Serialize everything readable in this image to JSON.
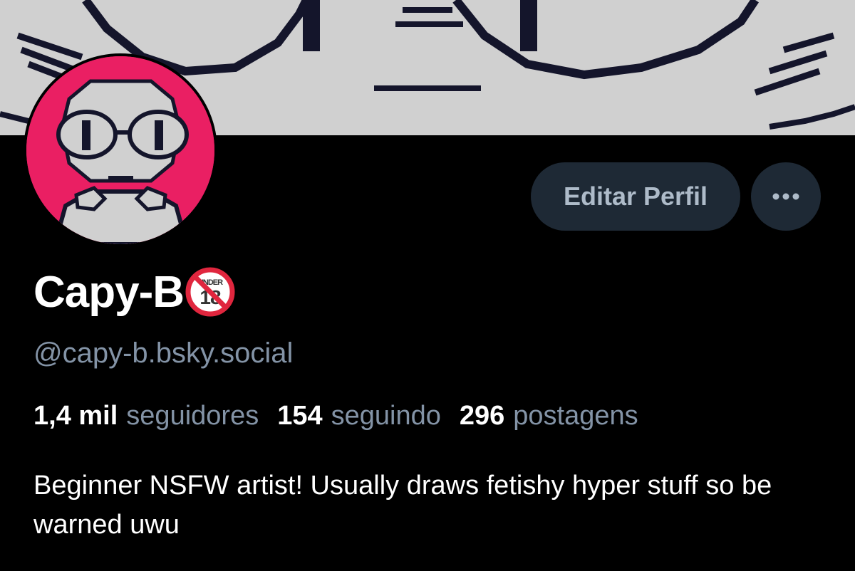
{
  "profile": {
    "display_name": "Capy-B",
    "badge_text": "UNDER",
    "badge_number": "18",
    "handle": "@capy-b.bsky.social",
    "bio": "Beginner NSFW artist! Usually draws fetishy hyper stuff so be warned uwu"
  },
  "actions": {
    "edit_label": "Editar Perfil",
    "more_icon": "ellipsis-icon"
  },
  "stats": {
    "followers_count": "1,4 mil",
    "followers_label": "seguidores",
    "following_count": "154",
    "following_label": "seguindo",
    "posts_count": "296",
    "posts_label": "postagens"
  },
  "colors": {
    "background": "#000000",
    "banner": "#d0d0d0",
    "avatar_accent": "#ea1f63",
    "button_bg": "#1e2935",
    "muted_text": "#8393a6",
    "badge_red": "#e0263e"
  }
}
